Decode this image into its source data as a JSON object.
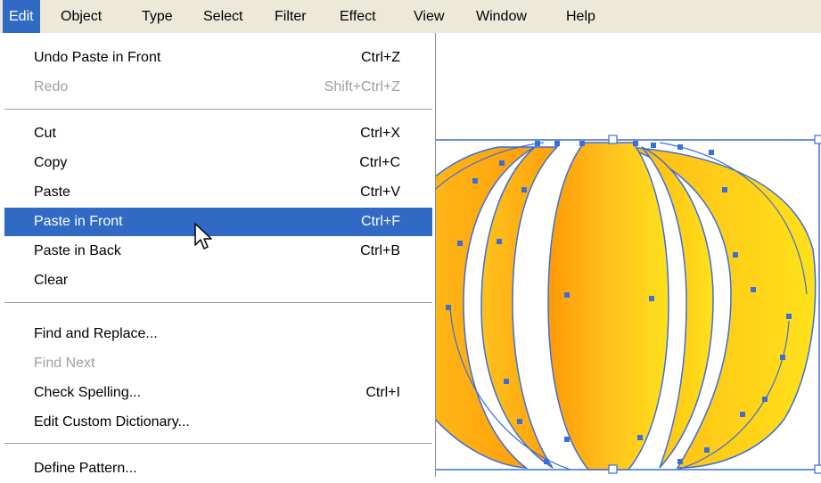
{
  "menubar": {
    "items": [
      {
        "label": "Edit",
        "active": true
      },
      {
        "label": "Object"
      },
      {
        "label": "Type"
      },
      {
        "label": "Select"
      },
      {
        "label": "Filter"
      },
      {
        "label": "Effect"
      },
      {
        "label": "View"
      },
      {
        "label": "Window"
      },
      {
        "label": "Help"
      }
    ]
  },
  "edit_menu": {
    "undo": {
      "label": "Undo Paste in Front",
      "shortcut": "Ctrl+Z"
    },
    "redo": {
      "label": "Redo",
      "shortcut": "Shift+Ctrl+Z"
    },
    "cut": {
      "label": "Cut",
      "shortcut": "Ctrl+X"
    },
    "copy": {
      "label": "Copy",
      "shortcut": "Ctrl+C"
    },
    "paste": {
      "label": "Paste",
      "shortcut": "Ctrl+V"
    },
    "paste_front": {
      "label": "Paste in Front",
      "shortcut": "Ctrl+F"
    },
    "paste_back": {
      "label": "Paste in Back",
      "shortcut": "Ctrl+B"
    },
    "clear": {
      "label": "Clear"
    },
    "find_replace": {
      "label": "Find and Replace..."
    },
    "find_next": {
      "label": "Find Next"
    },
    "check_spelling": {
      "label": "Check Spelling...",
      "shortcut": "Ctrl+I"
    },
    "edit_dictionary": {
      "label": "Edit Custom Dictionary..."
    },
    "define_pattern": {
      "label": "Define Pattern..."
    }
  },
  "colors": {
    "menu_bar": "#ece9d8",
    "highlight": "#316ac5",
    "disabled_text": "#a0a0a0",
    "selection_path": "#3a6fd8",
    "pumpkin_light": "#ffe11a",
    "pumpkin_dark": "#ff9e0a"
  }
}
